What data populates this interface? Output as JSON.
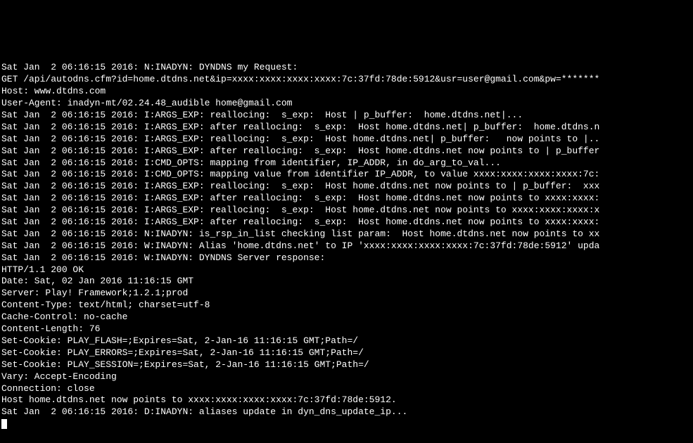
{
  "lines": [
    "Sat Jan  2 06:16:15 2016: N:INADYN: DYNDNS my Request:",
    "GET /api/autodns.cfm?id=home.dtdns.net&ip=xxxx:xxxx:xxxx:xxxx:7c:37fd:78de:5912&usr=user@gmail.com&pw=*******",
    "Host: www.dtdns.com",
    "User-Agent: inadyn-mt/02.24.48_audible home@gmail.com",
    "",
    "Sat Jan  2 06:16:15 2016: I:ARGS_EXP: reallocing:  s_exp:  Host | p_buffer:  home.dtdns.net|...",
    "Sat Jan  2 06:16:15 2016: I:ARGS_EXP: after reallocing:  s_exp:  Host home.dtdns.net| p_buffer:  home.dtdns.n",
    "Sat Jan  2 06:16:15 2016: I:ARGS_EXP: reallocing:  s_exp:  Host home.dtdns.net| p_buffer:   now points to |..",
    "Sat Jan  2 06:16:15 2016: I:ARGS_EXP: after reallocing:  s_exp:  Host home.dtdns.net now points to | p_buffer",
    "Sat Jan  2 06:16:15 2016: I:CMD_OPTS: mapping from identifier, IP_ADDR, in do_arg_to_val...",
    "Sat Jan  2 06:16:15 2016: I:CMD_OPTS: mapping value from identifier IP_ADDR, to value xxxx:xxxx:xxxx:xxxx:7c:",
    "Sat Jan  2 06:16:15 2016: I:ARGS_EXP: reallocing:  s_exp:  Host home.dtdns.net now points to | p_buffer:  xxx",
    "Sat Jan  2 06:16:15 2016: I:ARGS_EXP: after reallocing:  s_exp:  Host home.dtdns.net now points to xxxx:xxxx:",
    "Sat Jan  2 06:16:15 2016: I:ARGS_EXP: reallocing:  s_exp:  Host home.dtdns.net now points to xxxx:xxxx:xxxx:x",
    "Sat Jan  2 06:16:15 2016: I:ARGS_EXP: after reallocing:  s_exp:  Host home.dtdns.net now points to xxxx:xxxx:",
    "Sat Jan  2 06:16:15 2016: N:INADYN: is_rsp_in_list checking list param:  Host home.dtdns.net now points to xx",
    "Sat Jan  2 06:16:15 2016: W:INADYN: Alias 'home.dtdns.net' to IP 'xxxx:xxxx:xxxx:xxxx:7c:37fd:78de:5912' upda",
    "Sat Jan  2 06:16:15 2016: W:INADYN: DYNDNS Server response:",
    "HTTP/1.1 200 OK",
    "Date: Sat, 02 Jan 2016 11:16:15 GMT",
    "Server: Play! Framework;1.2.1;prod",
    "Content-Type: text/html; charset=utf-8",
    "Cache-Control: no-cache",
    "Content-Length: 76",
    "Set-Cookie: PLAY_FLASH=;Expires=Sat, 2-Jan-16 11:16:15 GMT;Path=/",
    "Set-Cookie: PLAY_ERRORS=;Expires=Sat, 2-Jan-16 11:16:15 GMT;Path=/",
    "Set-Cookie: PLAY_SESSION=;Expires=Sat, 2-Jan-16 11:16:15 GMT;Path=/",
    "Vary: Accept-Encoding",
    "Connection: close",
    "",
    "Host home.dtdns.net now points to xxxx:xxxx:xxxx:xxxx:7c:37fd:78de:5912.",
    "",
    "Sat Jan  2 06:16:15 2016: D:INADYN: aliases update in dyn_dns_update_ip..."
  ]
}
